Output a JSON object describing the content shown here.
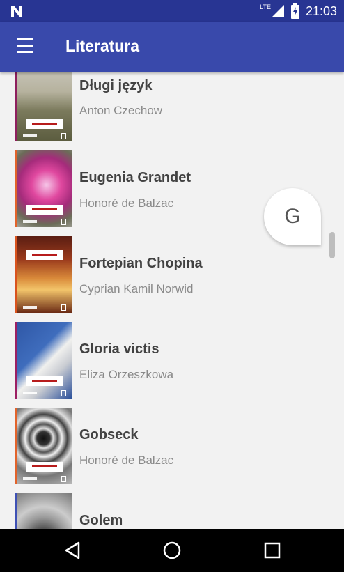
{
  "status_bar": {
    "network": "LTE",
    "time": "21:03"
  },
  "toolbar": {
    "title": "Literatura"
  },
  "books": [
    {
      "title": "Długi język",
      "author": "Anton Czechow",
      "stripe": "#8e1f5e",
      "bg": "linear-gradient(180deg,#c9c7bc 0%,#b6b29e 35%,#7b7a5c 60%,#5b5c3f 100%)"
    },
    {
      "title": "Eugenia Grandet",
      "author": "Honoré de Balzac",
      "stripe": "#e2632b",
      "bg": "radial-gradient(circle at 55% 45%,#f6c6e8 0%,#e0489f 28%,#a52b7b 52%,#6b6c58 75%,#a9a9a0 100%)"
    },
    {
      "title": "Fortepian Chopina",
      "author": "Cyprian Kamil Norwid",
      "stripe": "#d9531e",
      "bg": "linear-gradient(180deg,#5a1d12 0%,#9a3a1c 30%,#d98a3a 55%,#f2c46a 70%,#6b2b15 100%)"
    },
    {
      "title": "Gloria victis",
      "author": "Eliza Orzeszkowa",
      "stripe": "#9c1f63",
      "bg": "linear-gradient(135deg,#2e56a5 0%,#3f6dbd 40%,#f0f0ee 55%,#c9ccd2 70%,#2a4f99 100%)"
    },
    {
      "title": "Gobseck",
      "author": "Honoré de Balzac",
      "stripe": "#e2632b",
      "bg": "radial-gradient(circle at 50% 40%,#111 0%,#333 12%,#ddd 18%,#555 26%,#eee 34%,#444 44%,#ddd 55%,#777 70%,#bbb 100%)"
    },
    {
      "title": "Golem",
      "author": "",
      "stripe": "#3f51b5",
      "bg": "radial-gradient(circle at 50% 60%,#333 0%,#555 20%,#999 40%,#ccc 60%,#777 100%)"
    }
  ],
  "fast_scroll_letter": "G",
  "nav_bar": {
    "back": "back-icon",
    "home": "home-icon",
    "recents": "recents-icon"
  }
}
